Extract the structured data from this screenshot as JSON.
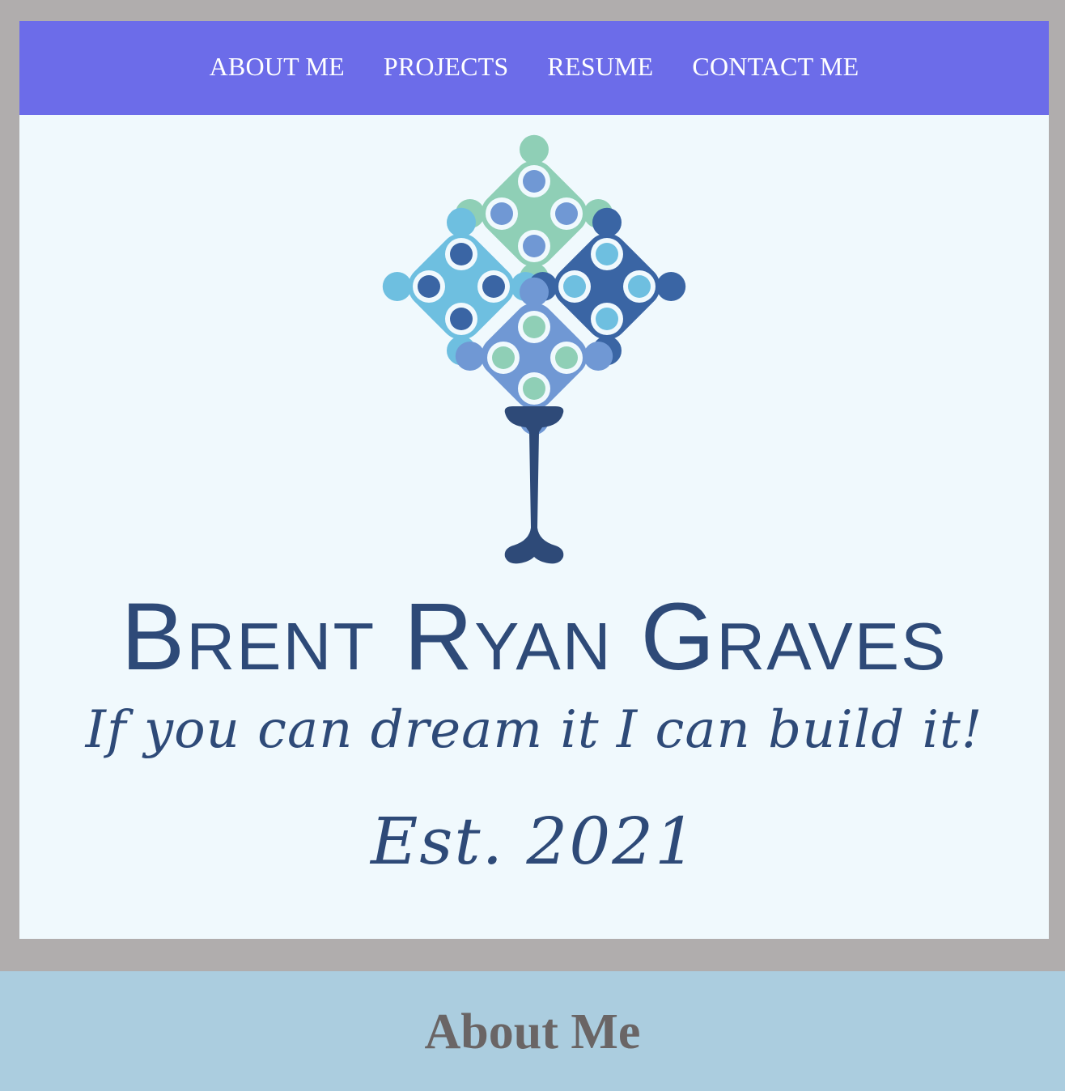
{
  "nav": {
    "items": [
      {
        "label": "ABOUT ME"
      },
      {
        "label": "PROJECTS"
      },
      {
        "label": "RESUME"
      },
      {
        "label": "CONTACT ME"
      }
    ]
  },
  "hero": {
    "logo_icon": "tree-logo-icon",
    "name_first": "Brent",
    "name_middle": "Ryan",
    "name_last": "Graves",
    "tagline": "If you can dream it I can build it!",
    "established": "Est. 2021"
  },
  "about": {
    "heading": "About Me"
  },
  "colors": {
    "nav_background": "#6c6ce9",
    "page_border": "#b0adad",
    "hero_background": "#f0f9fd",
    "brand_text": "#2e4a78",
    "about_background": "#abcddf",
    "about_heading": "#6a6565"
  }
}
